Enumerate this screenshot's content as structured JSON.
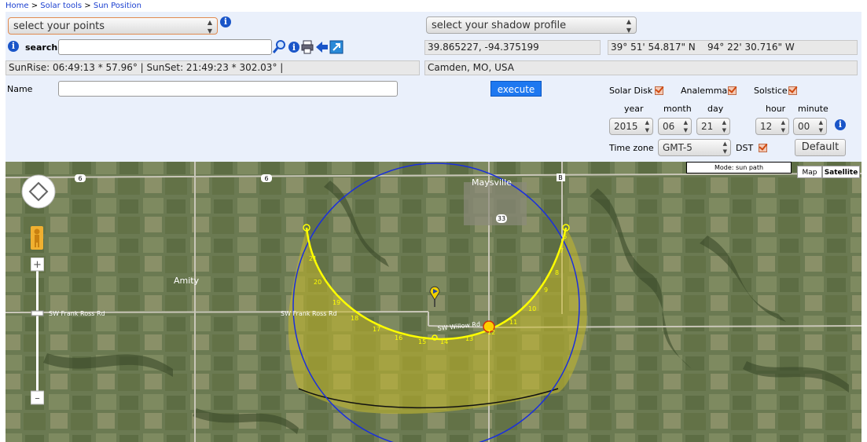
{
  "breadcrumb": {
    "home": "Home",
    "sep1": ">",
    "solar": "Solar tools",
    "sep2": ">",
    "current": "Sun Position"
  },
  "points_select": {
    "value": "select your points"
  },
  "shadow_select": {
    "value": "select your shadow profile"
  },
  "search": {
    "label": "search",
    "value": ""
  },
  "coords": {
    "decimal": "39.865227, -94.375199",
    "dms_lat": "39° 51' 54.817\" N",
    "dms_lon": "94° 22' 30.716\" W"
  },
  "sun_info": "SunRise: 06:49:13 * 57.96° | SunSet: 21:49:23 * 302.03° |",
  "place": "Camden, MO, USA",
  "name_label": "Name",
  "name_value": "",
  "execute_label": "execute",
  "options": {
    "solar_disk": "Solar Disk",
    "analemma": "Analemma",
    "solstice": "Solstice",
    "dst": "DST",
    "time_zone": "Time zone"
  },
  "date_labels": {
    "year": "year",
    "month": "month",
    "day": "day",
    "hour": "hour",
    "minute": "minute"
  },
  "date_values": {
    "year": "2015",
    "month": "06",
    "day": "21",
    "hour": "12",
    "minute": "00",
    "timezone": "GMT-5"
  },
  "default_label": "Default",
  "map": {
    "mode": "Mode: sun path",
    "type_map": "Map",
    "type_sat": "Satellite",
    "places": {
      "maysville": "Maysville",
      "amity": "Amity"
    },
    "roads": {
      "frank_ross_w": "SW Frank Ross Rd",
      "frank_ross_e": "SW Frank Ross Rd",
      "willow": "SW Willow Rd"
    },
    "shields": {
      "r6a": "6",
      "r6b": "6",
      "r33": "33",
      "rB": "B"
    },
    "hours": [
      "21",
      "20",
      "19",
      "18",
      "17",
      "16",
      "15",
      "14",
      "13",
      "12",
      "11",
      "10",
      "9",
      "8",
      "7",
      "6"
    ],
    "colors": {
      "path": "#ffff00",
      "fill": "#b8b020",
      "circle": "#1a2fdc",
      "shadow_edge": "#111111",
      "sun": "#ffd000"
    }
  }
}
